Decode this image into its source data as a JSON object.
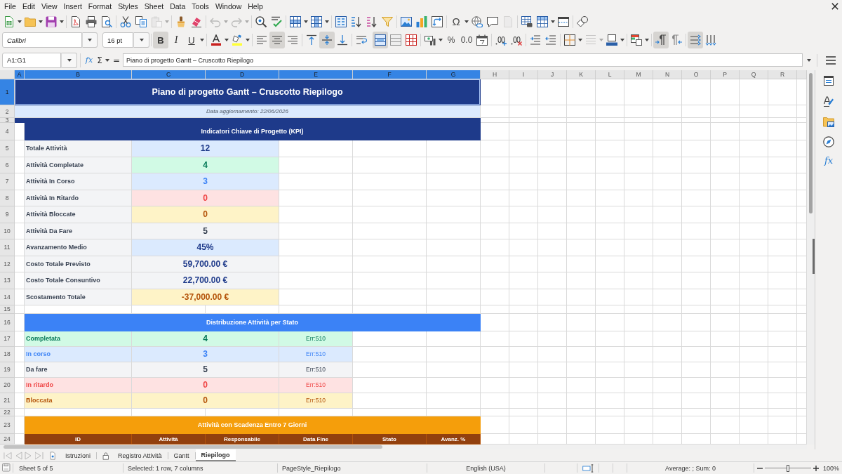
{
  "menu_bar": [
    "File",
    "Edit",
    "View",
    "Insert",
    "Format",
    "Styles",
    "Sheet",
    "Data",
    "Tools",
    "Window",
    "Help"
  ],
  "standard_toolbar": {
    "special_character": "Ω"
  },
  "formatting_toolbar": {
    "font_name": "Calibri",
    "font_size": "16 pt",
    "text_styles": [
      {
        "kind": "bold",
        "label": "B",
        "on": true
      },
      {
        "kind": "italic",
        "label": "I",
        "on": false
      },
      {
        "kind": "underline",
        "label": "U",
        "on": false
      }
    ],
    "horizontal_align": {
      "left": false,
      "center": true,
      "right": false
    },
    "vertical_align": {
      "top": false,
      "middle": true,
      "bottom": false
    },
    "merge_and_center": true,
    "number_formats": [
      "%",
      "0.0"
    ],
    "paragraph_direction": {
      "left_to_right": true,
      "right_to_left": false
    },
    "text_direction": {
      "horizontal": true,
      "vertical": false
    }
  },
  "formula_bar": {
    "name_box": "A1:G1",
    "function_wizard": "fx",
    "sum": "Σ",
    "equals": "=",
    "content": "Piano di progetto Gantt – Cruscotto Riepilogo"
  },
  "sidebar": {
    "functions": "fx"
  },
  "columns": [
    {
      "label": "A",
      "selected": true
    },
    {
      "label": "B",
      "selected": true
    },
    {
      "label": "C",
      "selected": true
    },
    {
      "label": "D",
      "selected": true
    },
    {
      "label": "E",
      "selected": true
    },
    {
      "label": "F",
      "selected": true
    },
    {
      "label": "G",
      "selected": true
    },
    {
      "label": "H",
      "selected": false
    },
    {
      "label": "I",
      "selected": false
    },
    {
      "label": "J",
      "selected": false
    },
    {
      "label": "K",
      "selected": false
    },
    {
      "label": "L",
      "selected": false
    },
    {
      "label": "M",
      "selected": false
    },
    {
      "label": "N",
      "selected": false
    },
    {
      "label": "O",
      "selected": false
    },
    {
      "label": "P",
      "selected": false
    },
    {
      "label": "Q",
      "selected": false
    },
    {
      "label": "R",
      "selected": false
    }
  ],
  "rows": [
    {
      "header": "1",
      "selected": true,
      "kind": "title",
      "text": "Piano di progetto Gantt – Cruscotto Riepilogo"
    },
    {
      "header": "2",
      "selected": false,
      "kind": "subtitle",
      "text": "Data aggiornamento: 22/06/2026"
    },
    {
      "header": "3",
      "selected": false,
      "kind": "band",
      "color": "#1e3a8a"
    },
    {
      "header": "4",
      "selected": false,
      "kind": "section",
      "color": "#1e3a8a",
      "text": "Indicatori Chiave di Progetto (KPI)"
    },
    {
      "header": "5",
      "selected": false,
      "kind": "kpi",
      "label": "Totale Attività",
      "value": {
        "text": "12",
        "kind": "info"
      }
    },
    {
      "header": "6",
      "selected": false,
      "kind": "kpi",
      "label": "Attività Completate",
      "value": {
        "text": "4",
        "kind": "success"
      }
    },
    {
      "header": "7",
      "selected": false,
      "kind": "kpi",
      "label": "Attività In Corso",
      "value": {
        "text": "3",
        "kind": "progress"
      }
    },
    {
      "header": "8",
      "selected": false,
      "kind": "kpi",
      "label": "Attività In Ritardo",
      "value": {
        "text": "0",
        "kind": "danger"
      }
    },
    {
      "header": "9",
      "selected": false,
      "kind": "kpi",
      "label": "Attività Bloccate",
      "value": {
        "text": "0",
        "kind": "warning"
      }
    },
    {
      "header": "10",
      "selected": false,
      "kind": "kpi",
      "label": "Attività Da Fare",
      "value": {
        "text": "5",
        "kind": "neutral"
      }
    },
    {
      "header": "11",
      "selected": false,
      "kind": "kpi",
      "label": "Avanzamento Medio",
      "value": {
        "text": "45%",
        "kind": "info"
      }
    },
    {
      "header": "12",
      "selected": false,
      "kind": "kpi",
      "label": "Costo Totale Previsto",
      "value": {
        "text": "59,700.00 €",
        "kind": "plain"
      }
    },
    {
      "header": "13",
      "selected": false,
      "kind": "kpi",
      "label": "Costo Totale Consuntivo",
      "value": {
        "text": "22,700.00 €",
        "kind": "plain"
      }
    },
    {
      "header": "14",
      "selected": false,
      "kind": "kpi",
      "label": "Scostamento Totale",
      "value": {
        "text": "-37,000.00 €",
        "kind": "warning"
      }
    },
    {
      "header": "15",
      "selected": false,
      "kind": "blank"
    },
    {
      "header": "16",
      "selected": false,
      "kind": "section",
      "color": "#3b82f6",
      "text": "Distribuzione Attività per Stato"
    },
    {
      "header": "17",
      "selected": false,
      "kind": "status",
      "label": {
        "text": "Completata",
        "kind": "success"
      },
      "value": {
        "text": "4",
        "kind": "success"
      },
      "note": {
        "text": "Err:510",
        "kind": "success"
      }
    },
    {
      "header": "18",
      "selected": false,
      "kind": "status",
      "label": {
        "text": "In corso",
        "kind": "progress"
      },
      "value": {
        "text": "3",
        "kind": "progress"
      },
      "note": {
        "text": "Err:510",
        "kind": "progress"
      }
    },
    {
      "header": "19",
      "selected": false,
      "kind": "status",
      "label": {
        "text": "Da fare",
        "kind": "neutral"
      },
      "value": {
        "text": "5",
        "kind": "neutral"
      },
      "note": {
        "text": "Err:510",
        "kind": "neutral"
      }
    },
    {
      "header": "20",
      "selected": false,
      "kind": "status",
      "label": {
        "text": "In ritardo",
        "kind": "danger"
      },
      "value": {
        "text": "0",
        "kind": "danger"
      },
      "note": {
        "text": "Err:510",
        "kind": "danger"
      }
    },
    {
      "header": "21",
      "selected": false,
      "kind": "status",
      "label": {
        "text": "Bloccata",
        "kind": "warning"
      },
      "value": {
        "text": "0",
        "kind": "warning"
      },
      "note": {
        "text": "Err:510",
        "kind": "warning"
      }
    },
    {
      "header": "22",
      "selected": false,
      "kind": "blank"
    },
    {
      "header": "23",
      "selected": false,
      "kind": "section",
      "color": "#f59e0b",
      "text": "Attività con Scadenza Entro 7 Giorni"
    },
    {
      "header": "24",
      "selected": false,
      "kind": "table_header",
      "color": "#92400e",
      "cells": [
        "ID",
        "Attività",
        "Responsabile",
        "Data Fine",
        "Stato",
        "Avanz. %"
      ]
    }
  ],
  "sheet_tabs": [
    {
      "label": "Istruzioni",
      "kind": "note",
      "selected": false
    },
    {
      "label": "Registro Attività",
      "kind": "locked",
      "selected": false
    },
    {
      "label": "Gantt",
      "kind": "plain",
      "selected": false
    },
    {
      "label": "Riepilogo",
      "kind": "plain",
      "selected": true
    }
  ],
  "status_bar": {
    "sheet": "Sheet 5 of 5",
    "selection": "Selected: 1 row, 7 columns",
    "page_style": "PageStyle_Riepilogo",
    "language": "English (USA)",
    "summary": "Average: ; Sum: 0",
    "zoom": {
      "level": 0.5,
      "label": "100%"
    }
  }
}
